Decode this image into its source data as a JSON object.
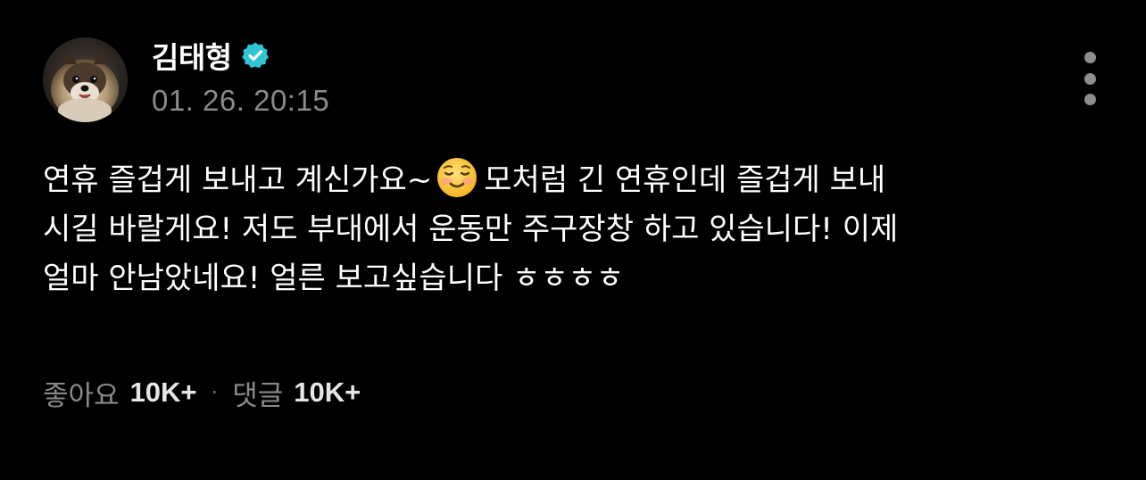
{
  "post": {
    "author": {
      "name": "김태형",
      "verified": true,
      "avatar_icon": "pomeranian-dog-avatar"
    },
    "timestamp": "01. 26. 20:15",
    "more_icon": "vertical-ellipsis-icon",
    "body": {
      "line1_before_emoji": "연휴 즐겁게 보내고 계신가요~",
      "emoji": "smiling-face-emoji",
      "line1_after_emoji": "모처럼 긴 연휴인데 즐겁게 보내",
      "line2": "시길 바랄게요! 저도 부대에서 운동만 주구장창 하고 있습니다! 이제",
      "line3": "얼마 안남았네요! 얼른 보고싶습니다 ㅎㅎㅎㅎ"
    },
    "stats": {
      "likes_label": "좋아요",
      "likes_count": "10K+",
      "separator": "·",
      "comments_label": "댓글",
      "comments_count": "10K+"
    },
    "colors": {
      "background": "#000000",
      "primary_text": "#ffffff",
      "secondary_text": "#8a8a8a",
      "verified_badge": "#2fc5d4"
    }
  }
}
